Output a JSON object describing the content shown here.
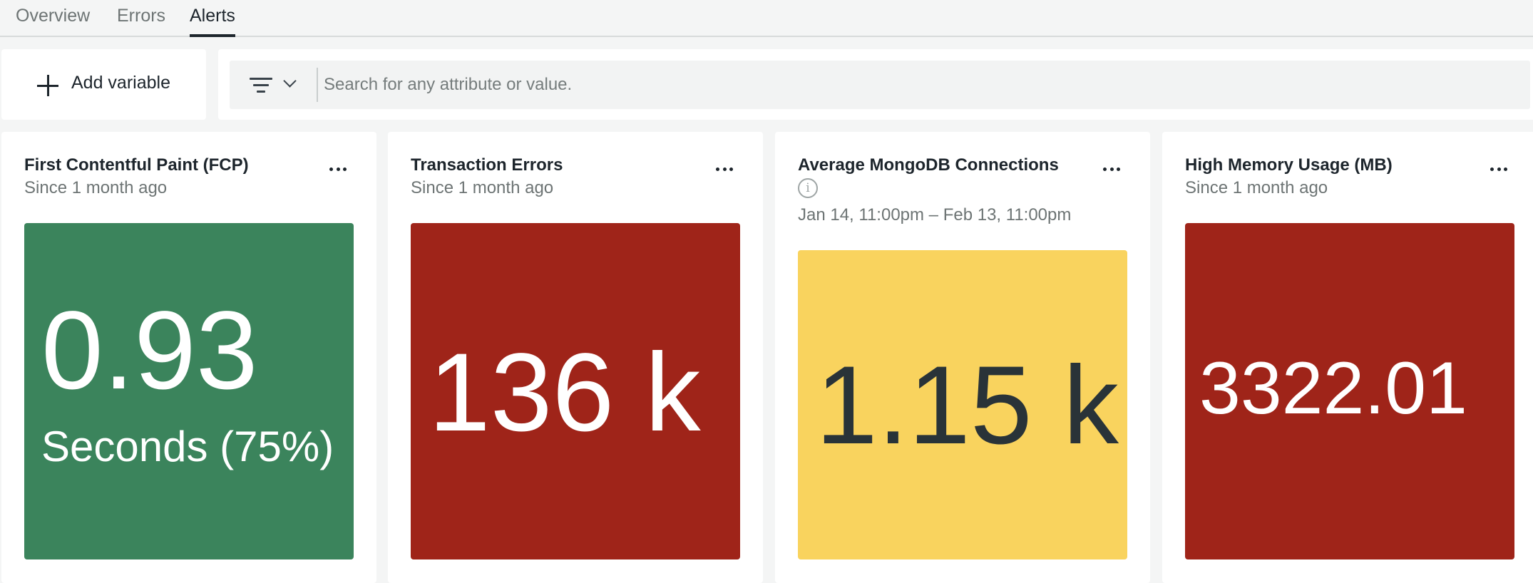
{
  "tabs": [
    {
      "label": "Overview",
      "active": false
    },
    {
      "label": "Errors",
      "active": false
    },
    {
      "label": "Alerts",
      "active": true
    }
  ],
  "toolbar": {
    "add_variable_label": "Add variable",
    "filter_icon": "filter-icon",
    "search_placeholder": "Search for any attribute or value."
  },
  "cards": [
    {
      "title": "First Contentful Paint (FCP)",
      "subtitle": "Since 1 month ago",
      "value": "0.93",
      "unit": "Seconds (75%)",
      "status_color": "#3b845c",
      "text_color": "#ffffff"
    },
    {
      "title": "Transaction Errors",
      "subtitle": "Since 1 month ago",
      "value": "136 k",
      "status_color": "#9f2419",
      "text_color": "#ffffff"
    },
    {
      "title": "Average MongoDB Connections",
      "info_icon": "info-icon",
      "range": "Jan 14, 11:00pm – Feb 13, 11:00pm",
      "value": "1.15 k",
      "status_color": "#f9d35e",
      "text_color": "#293338"
    },
    {
      "title": "High Memory Usage (MB)",
      "subtitle": "Since 1 month ago",
      "value": "3322.01",
      "status_color": "#9f2419",
      "text_color": "#ffffff"
    }
  ]
}
